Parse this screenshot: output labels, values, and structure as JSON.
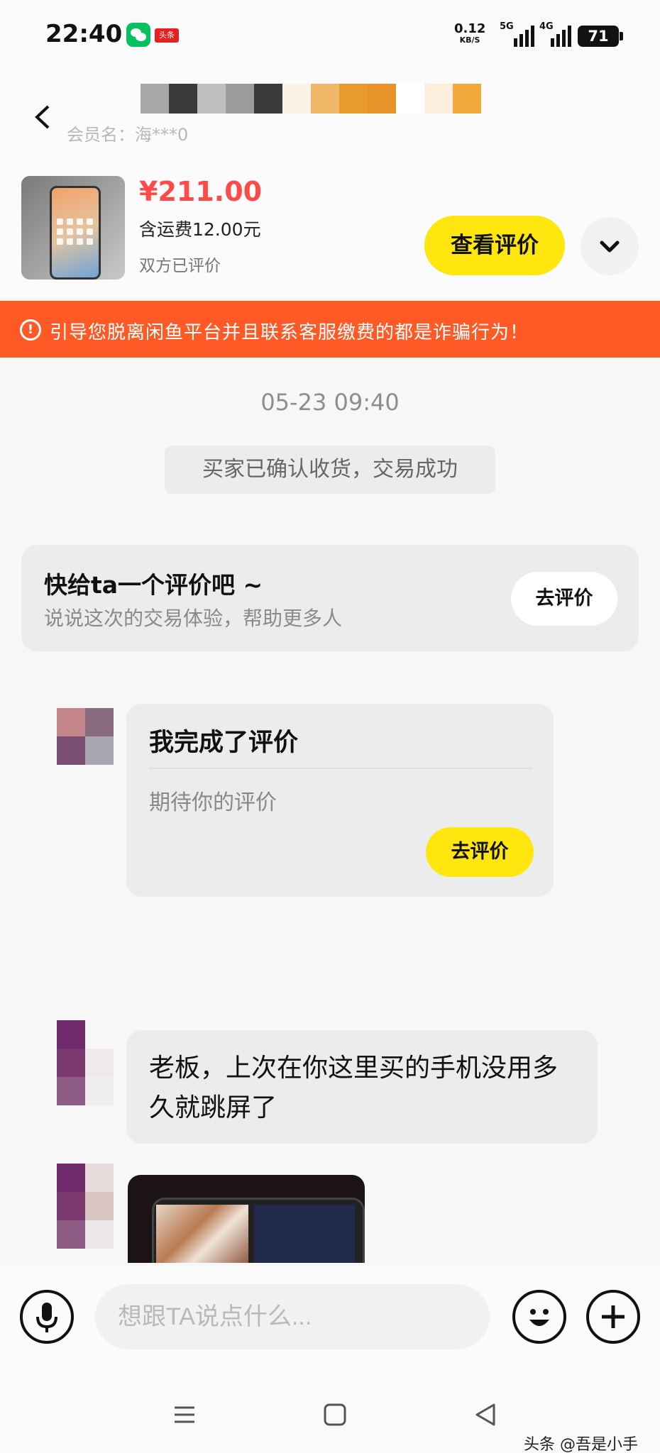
{
  "status_bar": {
    "time": "22:40",
    "toutiao_badge": "头条",
    "net_speed_value": "0.12",
    "net_speed_unit": "KB/S",
    "sim1_label": "5G",
    "sim2_label": "4G",
    "battery": "71"
  },
  "header": {
    "member_name": "会员名：海***0",
    "price": "¥211.00",
    "shipping": "含运费12.00元",
    "review_status": "双方已评价",
    "view_review_label": "查看评价",
    "pixel_colors": [
      "#a7a7a7",
      "#3a3a3a",
      "#bfbfbf",
      "#9c9c9c",
      "#3b3b3b",
      "#fcf2e6",
      "#efb869",
      "#e89a2a",
      "#e8922a",
      "#ffffff",
      "#fdeede",
      "#f3aa3c"
    ]
  },
  "warning": {
    "text": "引导您脱离闲鱼平台并且联系客服缴费的都是诈骗行为！",
    "color": "#ff5a26"
  },
  "chat": {
    "timestamp": "05-23 09:40",
    "system_message": "买家已确认收货，交易成功",
    "prompt_card": {
      "title": "快给ta一个评价吧 ~",
      "subtitle": "说说这次的交易体验，帮助更多人",
      "button": "去评价"
    },
    "review_card": {
      "title": "我完成了评价",
      "subtitle": "期待你的评价",
      "button": "去评价"
    },
    "message_text": "老板，上次在你这里买的手机没用多久就跳屏了"
  },
  "input": {
    "placeholder": "想跟TA说点什么..."
  },
  "watermark": "头条 @吾是小手",
  "colors": {
    "accent_yellow": "#ffe60f",
    "price_red": "#ff4a4a"
  }
}
